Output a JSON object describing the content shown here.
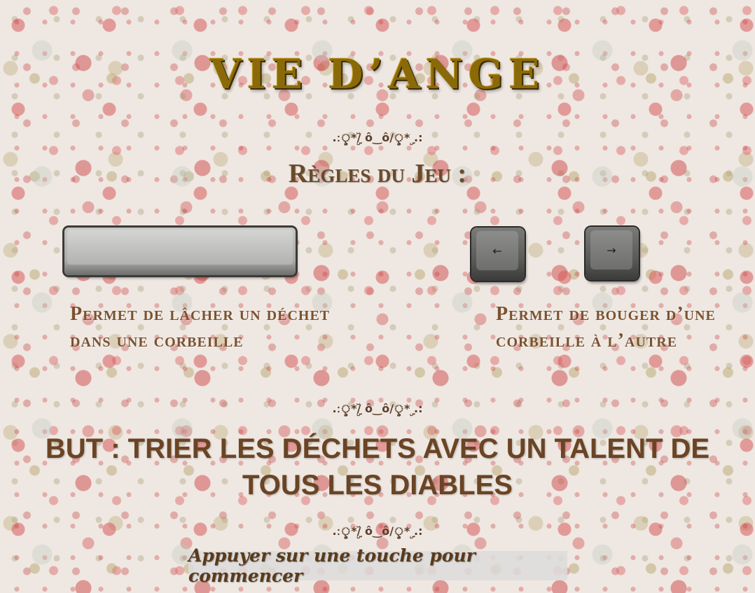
{
  "game": {
    "title": "VIE D’ANGE",
    "separator": ".:ৢ*ۣ/ ̆ô‿ô/ৢ*ۣ .:",
    "rules_heading": "Règles du Jeu :",
    "controls": {
      "drop": {
        "key": "spacebar-key",
        "description": "Permet de lâcher un déchet dans une corbeille"
      },
      "move": {
        "keys": [
          "left-arrow-key",
          "right-arrow-key"
        ],
        "left_symbol": "←",
        "right_symbol": "→",
        "description": "Permet de bouger d’une corbeille à l’autre"
      }
    },
    "goal": "BUT : TRIER LES DÉCHETS AVEC UN TALENT DE TOUS LES DIABLES",
    "start_prompt": "Appuyer sur une touche pour commencer"
  },
  "colors": {
    "title": "#8a6a08",
    "text_brown": "#6a4424",
    "prompt_bg": "#dcdcdc"
  }
}
